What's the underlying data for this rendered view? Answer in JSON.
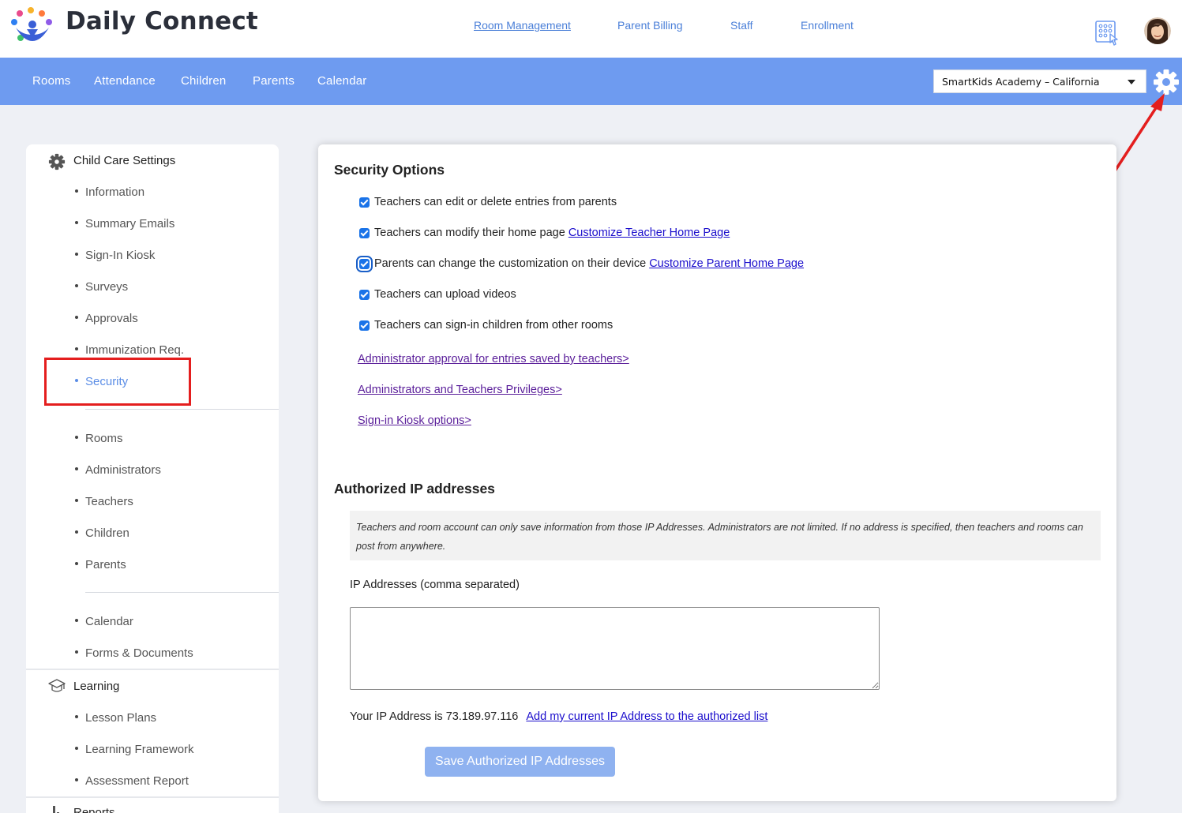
{
  "app": {
    "brand": "Daily Connect"
  },
  "top_nav": [
    {
      "label": "Room Management",
      "active": true
    },
    {
      "label": "Parent Billing",
      "active": false
    },
    {
      "label": "Staff",
      "active": false
    },
    {
      "label": "Enrollment",
      "active": false
    }
  ],
  "main_nav": [
    "Rooms",
    "Attendance",
    "Children",
    "Parents",
    "Calendar"
  ],
  "school_selector": {
    "value": "SmartKids Academy – California"
  },
  "sidebar": {
    "sections": [
      {
        "title": "Child Care Settings",
        "icon": "gear-icon"
      },
      {
        "title": "Learning",
        "icon": "graduation-cap-icon"
      },
      {
        "title": "Reports",
        "icon": "bar-chart-icon"
      }
    ],
    "settings_items": [
      "Information",
      "Summary Emails",
      "Sign-In Kiosk",
      "Surveys",
      "Approvals",
      "Immunization Req.",
      "Security"
    ],
    "manage_items": [
      "Rooms",
      "Administrators",
      "Teachers",
      "Children",
      "Parents"
    ],
    "calendar_items": [
      "Calendar",
      "Forms & Documents"
    ],
    "learning_items": [
      "Lesson Plans",
      "Learning Framework",
      "Assessment Report"
    ],
    "active_item": "Security"
  },
  "security": {
    "title": "Security Options",
    "options": [
      {
        "label": "Teachers can edit or delete entries from parents",
        "checked": true
      },
      {
        "label": "Teachers can modify their home page",
        "link": "Customize Teacher Home Page",
        "checked": true
      },
      {
        "label": "Parents can change the customization on their device",
        "link": "Customize Parent Home Page",
        "checked": true
      },
      {
        "label": "Teachers can upload videos",
        "checked": true
      },
      {
        "label": "Teachers can sign-in children from other rooms",
        "checked": true
      }
    ],
    "links": [
      "Administrator approval for entries saved by teachers>",
      "Administrators and Teachers Privileges>",
      "Sign-in Kiosk options>"
    ]
  },
  "ip": {
    "title": "Authorized IP addresses",
    "note": "Teachers and room account can only save information from those IP Addresses. Administrators are not limited. If no address is specified, then teachers and rooms can post from anywhere.",
    "field_label": "IP Addresses (comma separated)",
    "field_value": "",
    "current_ip_text": "Your IP Address is 73.189.97.116",
    "add_link": "Add my current IP Address to the authorized list",
    "save_button": "Save Authorized IP Addresses"
  },
  "colors": {
    "nav_blue": "#6e9bf0",
    "accent": "#5b8de6",
    "annotation_red": "#e41e1e"
  }
}
